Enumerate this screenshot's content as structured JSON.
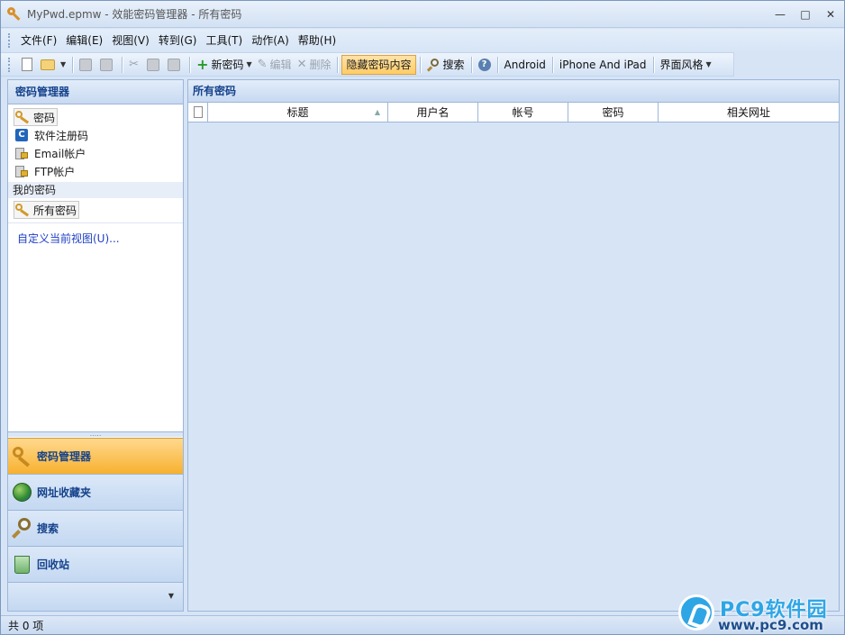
{
  "window": {
    "title": "MyPwd.epmw - 效能密码管理器 - 所有密码",
    "controls": [
      "—",
      "□",
      "✕"
    ]
  },
  "menu": [
    "文件(F)",
    "编辑(E)",
    "视图(V)",
    "转到(G)",
    "工具(T)",
    "动作(A)",
    "帮助(H)"
  ],
  "toolbar": {
    "new_label": "新密码",
    "edit_label": "编辑",
    "delete_label": "删除",
    "hide_label": "隐藏密码内容",
    "search_label": "搜索",
    "android_label": "Android",
    "iphone_label": "iPhone And iPad",
    "style_label": "界面风格"
  },
  "left_panel": {
    "header": "密码管理器",
    "tree": [
      "密码",
      "软件注册码",
      "Email帐户",
      "FTP帐户"
    ],
    "group_label": "我的密码",
    "all_passwords": "所有密码",
    "customize_link": "自定义当前视图(U)...",
    "nav": [
      "密码管理器",
      "网址收藏夹",
      "搜索",
      "回收站"
    ],
    "nav_active": 0
  },
  "right_panel": {
    "header": "所有密码",
    "columns": [
      "标题",
      "用户名",
      "帐号",
      "密码",
      "相关网址"
    ]
  },
  "status": {
    "count_text": "共 0 项"
  },
  "watermark": {
    "brand": "PC9软件园",
    "url": "www.pc9.com"
  },
  "colors": {
    "accent": "#15428b",
    "active_orange": "#f7b12f",
    "panel_bg": "#d6e4f5"
  }
}
